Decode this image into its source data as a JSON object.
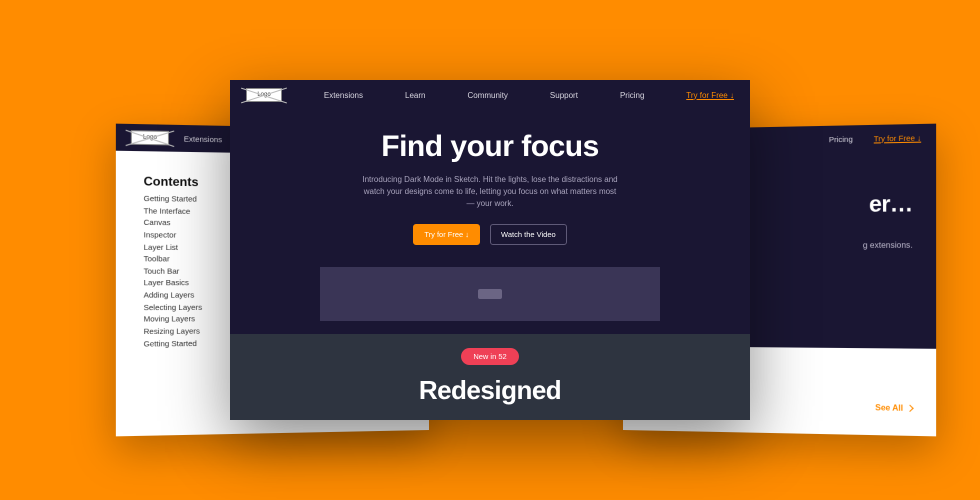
{
  "nav": {
    "logo_label": "Logo",
    "items": [
      "Extensions",
      "Learn",
      "Community",
      "Support",
      "Pricing"
    ],
    "cta": "Try for Free ↓"
  },
  "center": {
    "hero_title": "Find your focus",
    "hero_body": "Introducing Dark Mode in Sketch. Hit the lights, lose the distractions and watch your designs come to life, letting you focus on what matters most — your work.",
    "btn_primary": "Try for Free ↓",
    "btn_secondary": "Watch the Video",
    "badge": "New in 52",
    "band_title": "Redesigned"
  },
  "left": {
    "toc_title": "Contents",
    "toc_items": [
      "Getting Started",
      "The Interface",
      "Canvas",
      "Inspector",
      "Layer List",
      "Toolbar",
      "Touch Bar",
      "Layer Basics",
      "Adding Layers",
      "Selecting Layers",
      "Moving Layers",
      "Resizing Layers",
      "Getting Started"
    ]
  },
  "right": {
    "hero_title_fragment": "er…",
    "hero_sub_fragment": "g extensions.",
    "see_all": "See All"
  }
}
